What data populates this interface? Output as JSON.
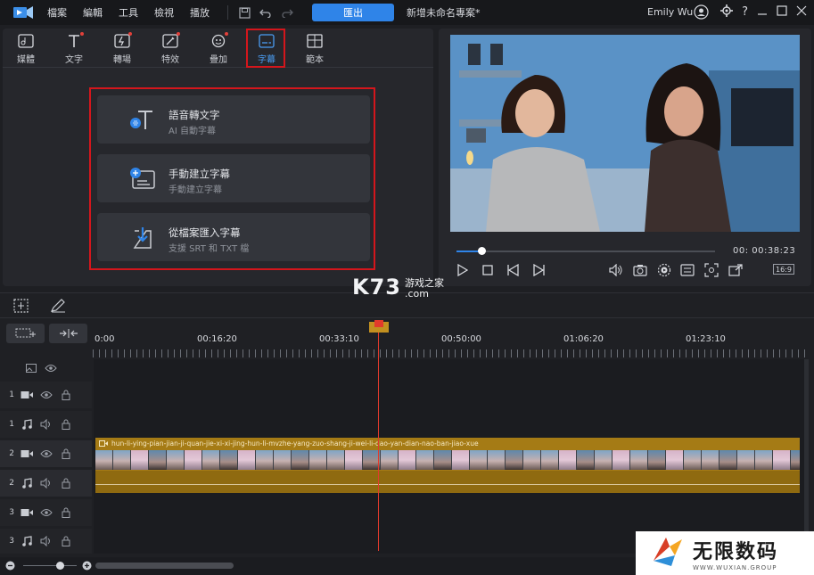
{
  "menu": [
    "檔案",
    "編輯",
    "工具",
    "檢視",
    "播放"
  ],
  "toolbar": {
    "export_label": "匯出",
    "project_name": "新增未命名專案*"
  },
  "user": {
    "name": "Emily Wu"
  },
  "window": {
    "help": "?"
  },
  "tabs": [
    {
      "label": "媒體",
      "icon": "media-icon"
    },
    {
      "label": "文字",
      "icon": "text-icon"
    },
    {
      "label": "轉場",
      "icon": "transition-icon"
    },
    {
      "label": "特效",
      "icon": "effects-icon"
    },
    {
      "label": "疊加",
      "icon": "overlay-icon"
    },
    {
      "label": "字幕",
      "icon": "subtitle-icon",
      "active": true
    },
    {
      "label": "範本",
      "icon": "template-icon"
    }
  ],
  "subtitle_options": [
    {
      "title": "語音轉文字",
      "subtitle": "AI 自動字幕"
    },
    {
      "title": "手動建立字幕",
      "subtitle": "手動建立字幕"
    },
    {
      "title": "從檔案匯入字幕",
      "subtitle": "支援 SRT 和 TXT 檔"
    }
  ],
  "preview": {
    "timecode": "00: 00:38:23",
    "progress": 0.1,
    "aspect_ratio": "16:9"
  },
  "timeline": {
    "ruler_labels": [
      "0:00",
      "00:16:20",
      "00:33:10",
      "00:50:00",
      "01:06:20",
      "01:23:10"
    ],
    "track_numbers": [
      "1",
      "1",
      "2",
      "2",
      "3",
      "3"
    ],
    "clip_title": "hun-li-ying-pian-jian-ji-quan-jie-xi-xi-jing-hun-li-mvzhe-yang-zuo-shang-ji-wei-li-dao-yan-dian-nao-ban-jiao-xue"
  },
  "watermarks": {
    "k73_big": "K73",
    "k73_cn": "游戏之家",
    "k73_com": ".com",
    "wuxian_cn": "无限数码",
    "wuxian_en": "WWW.WUXIAN.GROUP"
  },
  "colors": {
    "accent": "#2f84e8",
    "highlight": "#d4161c",
    "clip": "#a57b15",
    "playhead": "#e23a2c"
  }
}
